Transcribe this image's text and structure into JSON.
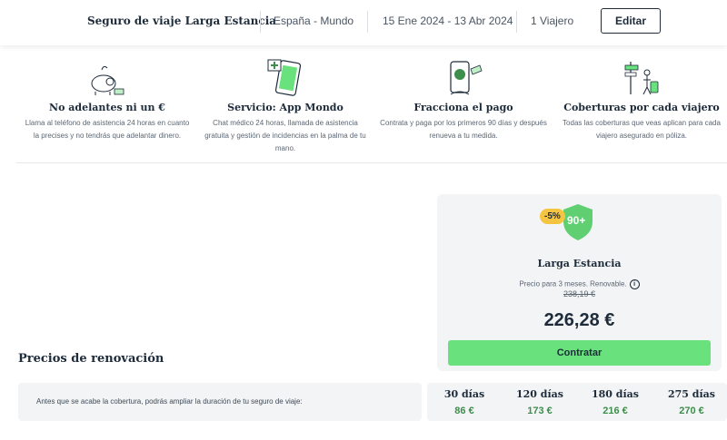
{
  "header": {
    "title": "Seguro de viaje Larga Estancia",
    "destination": "España - Mundo",
    "dates": "15 Ene 2024 - 13 Abr 2024",
    "travelers": "1 Viajero",
    "edit_label": "Editar"
  },
  "features": [
    {
      "icon": "piggy-bank-icon",
      "title": "No adelantes ni un €",
      "text": "Llama al teléfono de asistencia 24 horas en cuanto la precises y no tendrás que adelantar dinero."
    },
    {
      "icon": "mobile-app-icon",
      "title": "Servicio: App Mondo",
      "text": "Chat médico 24 horas, llamada de asistencia gratuita y gestión de incidencias en la palma de tu mano."
    },
    {
      "icon": "payment-phone-icon",
      "title": "Fracciona el pago",
      "text": "Contrata y paga por los primeros 90 días y después renueva a tu medida."
    },
    {
      "icon": "travelers-signpost-icon",
      "title": "Coberturas por cada viajero",
      "text": "Todas las coberturas que veas aplican para cada viajero asegurado en póliza."
    }
  ],
  "card": {
    "discount": "-5%",
    "days_badge": "90+",
    "name": "Larga Estancia",
    "note": "Precio para 3 meses. Renovable.",
    "info_glyph": "i",
    "old_price": "238,19 €",
    "price": "226,28 €",
    "buy_label": "Contratar"
  },
  "renewal": {
    "title": "Precios de renovación",
    "text": "Antes que se acabe la cobertura, podrás ampliar la duración de tu seguro de viaje:",
    "options": [
      {
        "days": "30 días",
        "price": "86 €"
      },
      {
        "days": "120 días",
        "price": "173 €"
      },
      {
        "days": "180 días",
        "price": "216 €"
      },
      {
        "days": "275 días",
        "price": "270 €"
      }
    ]
  },
  "colors": {
    "accent_green": "#69e27d",
    "price_green": "#3e8e4d",
    "badge_yellow": "#f5c542",
    "text_dark": "#1d2b3a"
  }
}
